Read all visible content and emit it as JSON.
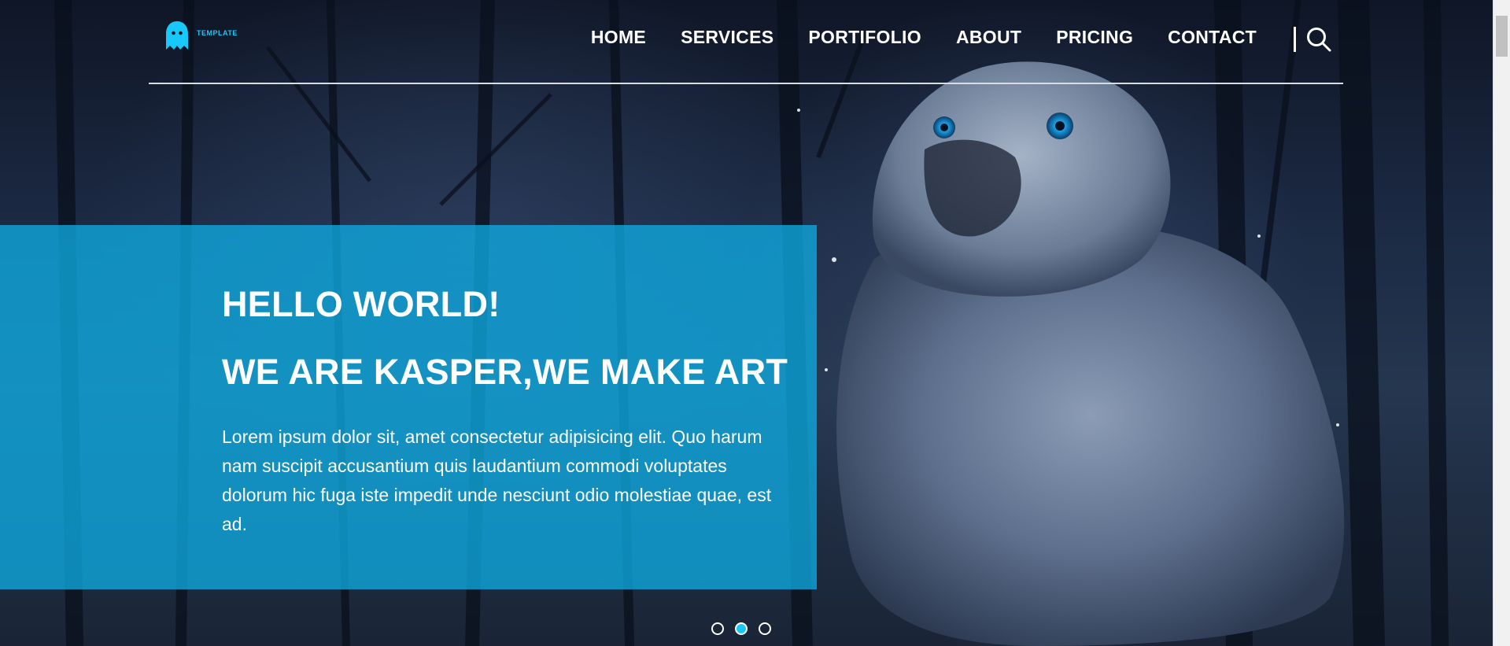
{
  "header": {
    "logo_icon": "ghost-icon",
    "logo_tag": "TEMPLATE",
    "nav": [
      {
        "label": "HOME"
      },
      {
        "label": "SERVICES"
      },
      {
        "label": "PORTIFOLIO"
      },
      {
        "label": "ABOUT"
      },
      {
        "label": "PRICING"
      },
      {
        "label": "CONTACT"
      }
    ],
    "search_icon": "search-icon"
  },
  "hero": {
    "title_line1": "HELLO WORLD!",
    "title_line2": "WE ARE KASPER,WE MAKE ART",
    "paragraph": "Lorem ipsum dolor sit, amet consectetur adipisicing elit. Quo harum nam suscipit accusantium quis laudantium commodi voluptates dolorum hic fuga iste impedit unde nesciunt odio molestiae quae, est ad.",
    "slide_count": 3,
    "active_slide": 2
  },
  "colors": {
    "accent": "#19c8fa",
    "panel": "#0eaae0",
    "text": "#ffffff"
  }
}
